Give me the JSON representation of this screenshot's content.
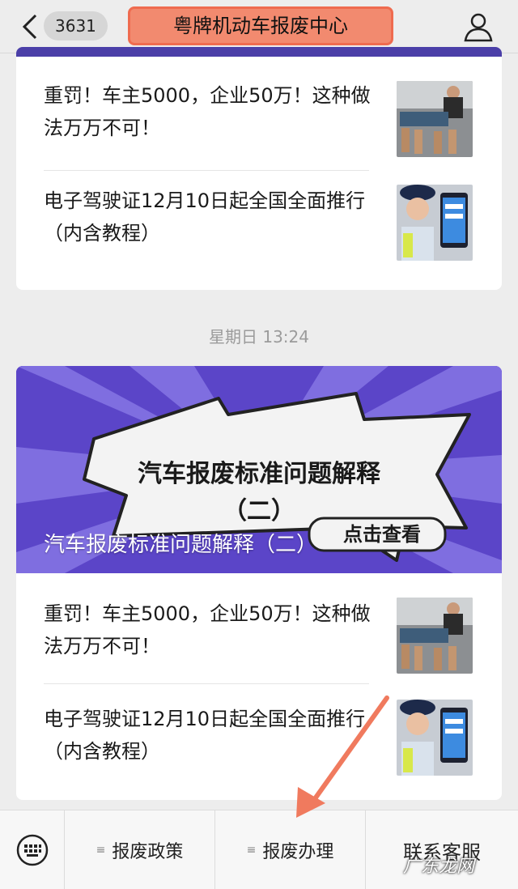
{
  "navbar": {
    "unread_count": "3631",
    "title": "粤牌机动车报废中心"
  },
  "feed": {
    "group1": {
      "articles": [
        {
          "title": "重罚！车主5000，企业50万！这种做法万万不可！",
          "thumb_icon": "mechanic-parts-photo"
        },
        {
          "title": "电子驾驶证12月10日起全国全面推行（内含教程）",
          "thumb_icon": "officer-phone-photo"
        }
      ]
    },
    "timestamp": "星期日 13:24",
    "group2": {
      "banner": {
        "bubble_title": "汽车报废标准问题解释",
        "bubble_subtitle": "（二）",
        "cta": "点击查看",
        "headline": "汽车报废标准问题解释（二）"
      },
      "articles": [
        {
          "title": "重罚！车主5000，企业50万！这种做法万万不可！",
          "thumb_icon": "mechanic-parts-photo"
        },
        {
          "title": "电子驾驶证12月10日起全国全面推行（内含教程）",
          "thumb_icon": "officer-phone-photo"
        }
      ]
    }
  },
  "menu": {
    "items": [
      {
        "label": "报废政策"
      },
      {
        "label": "报废办理"
      },
      {
        "label": "联系客服"
      }
    ]
  },
  "watermark": "广东龙网",
  "colors": {
    "highlight": "#f28a6f",
    "banner_purple": "#5b45c8",
    "arrow": "#f07a5e"
  }
}
